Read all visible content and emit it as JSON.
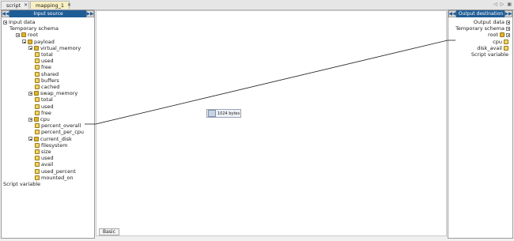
{
  "tabs": [
    {
      "label": "script",
      "icon": "script-icon",
      "active": false
    },
    {
      "label": "mapping_1",
      "icon": "mapping-icon",
      "active": true
    }
  ],
  "input_panel": {
    "title": "Input source",
    "collapse": "◀◀",
    "expand": "▶▶",
    "tree": [
      {
        "label": "Input data",
        "level": 0,
        "kind": "exp"
      },
      {
        "label": "Temporary schema",
        "level": 1,
        "kind": "none"
      },
      {
        "label": "root",
        "level": 2,
        "kind": "node"
      },
      {
        "label": "payload",
        "level": 3,
        "kind": "node"
      },
      {
        "label": "virtual_memory",
        "level": 4,
        "kind": "node"
      },
      {
        "label": "total",
        "level": 5,
        "kind": "leaf"
      },
      {
        "label": "used",
        "level": 5,
        "kind": "leaf"
      },
      {
        "label": "free",
        "level": 5,
        "kind": "leaf"
      },
      {
        "label": "shared",
        "level": 5,
        "kind": "leaf"
      },
      {
        "label": "buffers",
        "level": 5,
        "kind": "leaf"
      },
      {
        "label": "cached",
        "level": 5,
        "kind": "leaf"
      },
      {
        "label": "swap_memory",
        "level": 4,
        "kind": "node"
      },
      {
        "label": "total",
        "level": 5,
        "kind": "leaf"
      },
      {
        "label": "used",
        "level": 5,
        "kind": "leaf"
      },
      {
        "label": "free",
        "level": 5,
        "kind": "leaf"
      },
      {
        "label": "cpu",
        "level": 4,
        "kind": "node"
      },
      {
        "label": "percent_overall",
        "level": 5,
        "kind": "leaf"
      },
      {
        "label": "percent_per_cpu",
        "level": 5,
        "kind": "leaf"
      },
      {
        "label": "current_disk",
        "level": 4,
        "kind": "node"
      },
      {
        "label": "filesystem",
        "level": 5,
        "kind": "leaf"
      },
      {
        "label": "size",
        "level": 5,
        "kind": "leaf"
      },
      {
        "label": "used",
        "level": 5,
        "kind": "leaf"
      },
      {
        "label": "avail",
        "level": 5,
        "kind": "leaf"
      },
      {
        "label": "used_percent",
        "level": 5,
        "kind": "leaf"
      },
      {
        "label": "mounted_on",
        "level": 5,
        "kind": "leaf"
      },
      {
        "label": "Script variable",
        "level": 0,
        "kind": "none"
      }
    ]
  },
  "output_panel": {
    "title": "Output destination",
    "collapse": "◀◀",
    "expand": "▶▶",
    "tree": [
      {
        "label": "Output data",
        "kind": "exp"
      },
      {
        "label": "Temporary schema",
        "kind": "exp"
      },
      {
        "label": "root",
        "kind": "node"
      },
      {
        "label": "cpu",
        "kind": "leaf"
      },
      {
        "label": "disk_avail",
        "kind": "leaf"
      },
      {
        "label": "Script variable",
        "kind": "none"
      }
    ]
  },
  "canvas": {
    "function_label": "1024 bytes",
    "bottom_tab": "Basic"
  }
}
